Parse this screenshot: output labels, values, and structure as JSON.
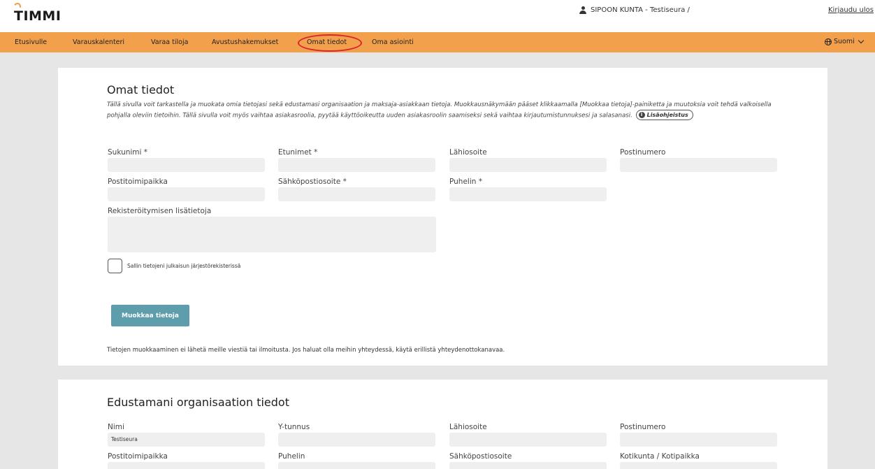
{
  "header": {
    "logo": "TIMMI",
    "user": "SIPOON KUNTA - Testiseura /",
    "logout": "Kirjaudu ulos"
  },
  "nav": {
    "items": [
      "Etusivulle",
      "Varauskalenteri",
      "Varaa tiloja",
      "Avustushakemukset",
      "Omat tiedot",
      "Oma asiointi"
    ],
    "language": "Suomi",
    "highlighted": "Omat tiedot"
  },
  "profile": {
    "title": "Omat tiedot",
    "intro": "Tällä sivulla voit tarkastella ja muokata omia tietojasi sekä edustamasi organisaation ja maksaja-asiakkaan tietoja. Muokkausnäkymään pääset klikkaamalla [Muokkaa tietoja]-painiketta ja muutoksia voit tehdä valkoisella pohjalla oleviin tietoihin. Tällä sivulla voit myös vaihtaa asiakasroolia, pyytää käyttöoikeutta uuden asiakasroolin saamiseksi sekä vaihtaa kirjautumistunnuksesi ja salasanasi.",
    "help_label": "Lisäohjeistus",
    "fields": {
      "sukunimi": "Sukunimi *",
      "etunimet": "Etunimet *",
      "lahiosoite": "Lähiosoite",
      "postinumero": "Postinumero",
      "postitoimipaikka": "Postitoimipaikka",
      "sahkoposti": "Sähköpostiosoite *",
      "puhelin": "Puhelin *",
      "lisatietoja": "Rekisteröitymisen lisätietoja"
    },
    "checkbox_label": "Sallin tietojeni julkaisun järjestörekisterissä",
    "edit_button": "Muokkaa tietoja",
    "note": "Tietojen muokkaaminen ei lähetä meille viestiä tai ilmoitusta. Jos haluat olla meihin yhteydessä, käytä erillistä yhteydenottokanavaa."
  },
  "organization": {
    "title": "Edustamani organisaation tiedot",
    "fields": {
      "nimi": "Nimi",
      "ytunnus": "Y-tunnus",
      "lahiosoite": "Lähiosoite",
      "postinumero": "Postinumero",
      "postitoimipaikka": "Postitoimipaikka",
      "puhelin": "Puhelin",
      "sahkoposti": "Sähköpostiosoite",
      "kotikunta": "Kotikunta / Kotipaikka"
    },
    "values": {
      "nimi": "Testiseura"
    }
  }
}
